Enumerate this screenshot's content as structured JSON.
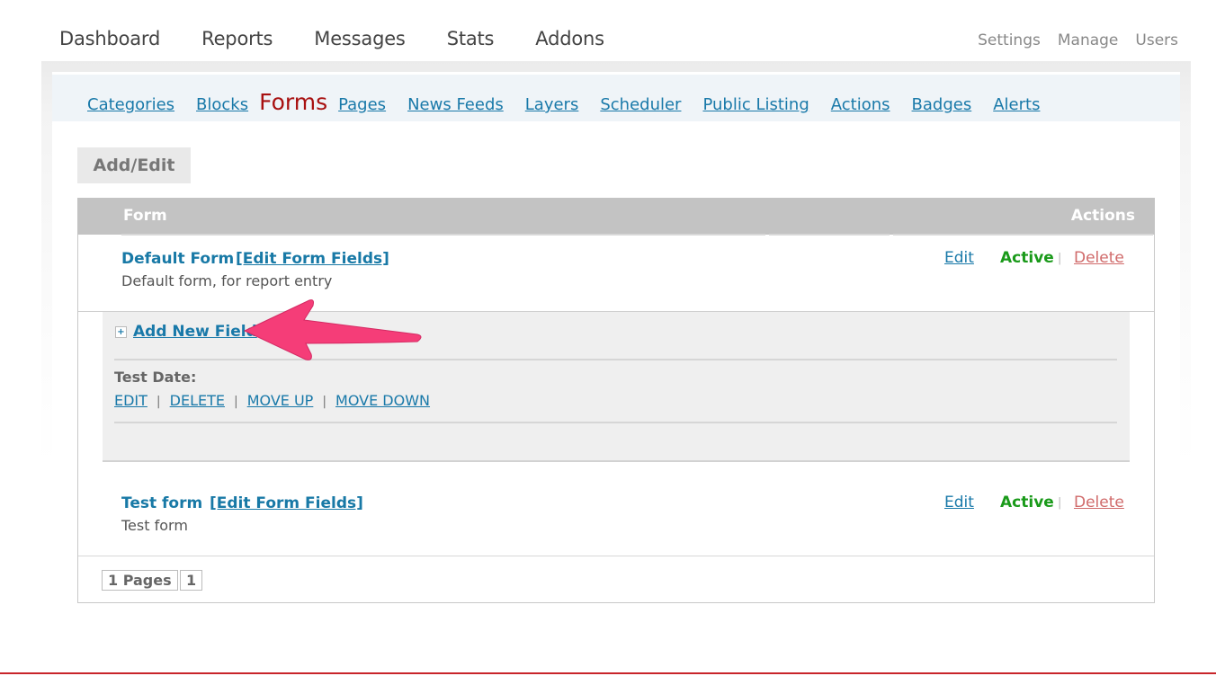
{
  "main_nav": [
    "Dashboard",
    "Reports",
    "Messages",
    "Stats",
    "Addons"
  ],
  "side_nav": [
    "Settings",
    "Manage",
    "Users"
  ],
  "sub_nav": {
    "before": [
      "Categories",
      "Blocks"
    ],
    "current": "Forms",
    "after": [
      "Pages",
      "News Feeds",
      "Layers",
      "Scheduler",
      "Public Listing",
      "Actions",
      "Badges",
      "Alerts"
    ]
  },
  "tab_label": "Add/Edit",
  "table": {
    "header_form": "Form",
    "header_actions": "Actions",
    "rows": [
      {
        "title": "Default Form",
        "edit_fields": "[Edit Form Fields]",
        "description": "Default form, for report entry",
        "edit": "Edit",
        "status": "Active",
        "separator": "|",
        "delete": "Delete"
      },
      {
        "title": "Test form",
        "edit_fields": "[Edit Form Fields]",
        "description": "Test form",
        "edit": "Edit",
        "status": "Active",
        "separator": "|",
        "delete": "Delete"
      }
    ]
  },
  "field_panel": {
    "add_field": "Add New Field",
    "plus": "+",
    "field_name": "Test Date:",
    "actions": [
      "EDIT",
      "DELETE",
      "MOVE UP",
      "MOVE DOWN"
    ],
    "pipe": "|"
  },
  "pagination": {
    "pages_label": "1 Pages",
    "current_page": "1"
  },
  "colors": {
    "link": "#1979a9",
    "current_tab": "#a81010",
    "active": "#1a9a1a",
    "delete": "#d06a6a",
    "annotation_arrow": "#f53d78"
  }
}
